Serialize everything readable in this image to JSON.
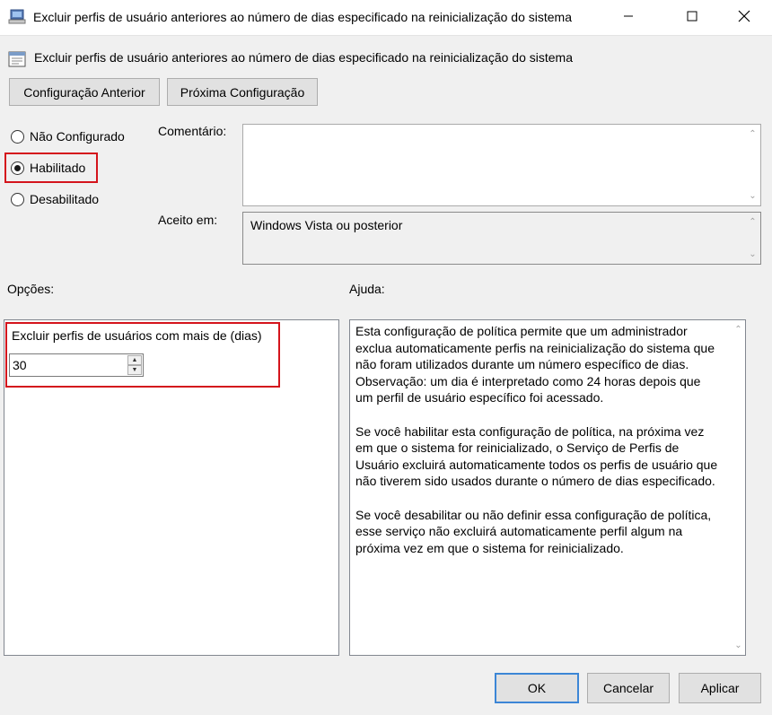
{
  "window": {
    "title": "Excluir perfis de usuário anteriores ao número de dias especificado na reinicialização do sistema",
    "controls": [
      "minimize-icon",
      "maximize-icon",
      "close-icon"
    ]
  },
  "header": {
    "setting_title": "Excluir perfis de usuário anteriores ao número de dias especificado na reinicialização do sistema",
    "prev_button": "Configuração Anterior",
    "next_button": "Próxima Configuração"
  },
  "state": {
    "options": [
      {
        "label": "Não Configurado",
        "checked": false
      },
      {
        "label": "Habilitado",
        "checked": true
      },
      {
        "label": "Desabilitado",
        "checked": false
      }
    ]
  },
  "comment": {
    "label": "Comentário:",
    "value": ""
  },
  "supported": {
    "label": "Aceito em:",
    "value": "Windows Vista ou posterior"
  },
  "options_section": {
    "label": "Opções:",
    "field_label": "Excluir perfis de usuários com mais de (dias)",
    "field_value": "30"
  },
  "help_section": {
    "label": "Ajuda:",
    "text": "Esta configuração de política permite que um administrador\nexclua automaticamente perfis na reinicialização do sistema que\nnão foram utilizados durante um número específico de dias.\nObservação: um dia é interpretado como 24 horas depois que\num perfil de usuário específico foi acessado.\n\nSe você habilitar esta configuração de política, na próxima vez\nem que o sistema for reinicializado, o Serviço de Perfis de\nUsuário excluirá automaticamente todos os perfis de usuário que\nnão tiverem sido usados durante o número de dias especificado.\n\nSe você desabilitar ou não definir essa configuração de política,\nesse serviço não excluirá automaticamente perfil algum na\npróxima vez em que o sistema for reinicializado."
  },
  "footer": {
    "ok": "OK",
    "cancel": "Cancelar",
    "apply": "Aplicar"
  },
  "colors": {
    "highlight": "#d4141c",
    "default_button_border": "#3c86d6",
    "dialog_bg": "#f0f0f0"
  }
}
